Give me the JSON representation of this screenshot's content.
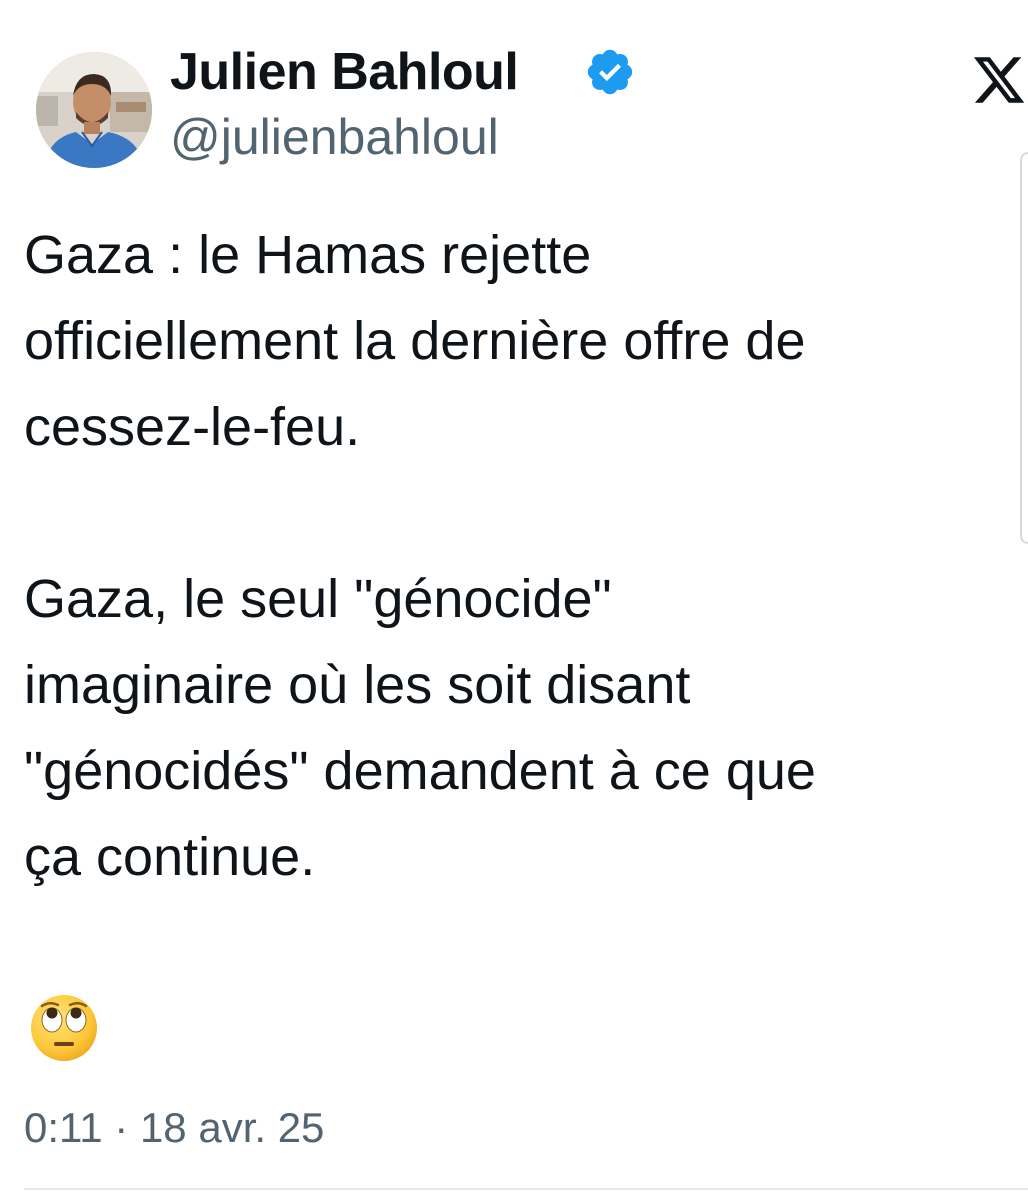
{
  "author": {
    "display_name": "Julien Bahloul",
    "handle": "@julienbahloul",
    "verified": true,
    "verified_color": "#1d9bf0"
  },
  "tweet": {
    "paragraph_1": [
      "Gaza : le Hamas rejette",
      "officiellement la dernière offre de",
      "cessez-le-feu."
    ],
    "paragraph_2": [
      "Gaza, le seul \"génocide\"",
      "imaginaire où les soit disant",
      "\"génocidés\" demandent à ce que",
      "ça continue."
    ],
    "emoji": "face-with-rolling-eyes",
    "timestamp": "0:11 · 18 avr. 25"
  },
  "brand": {
    "logo": "x-logo-icon"
  },
  "colors": {
    "text_primary": "#0f1419",
    "text_secondary": "#536471",
    "background": "#ffffff"
  }
}
